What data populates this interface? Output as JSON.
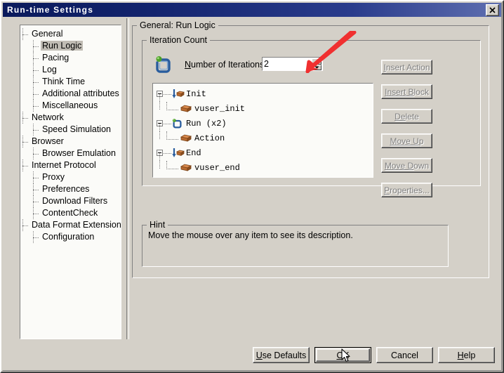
{
  "window": {
    "title": "Run-time Settings",
    "close_label": "✕"
  },
  "sidebar": {
    "items": [
      {
        "label": "General",
        "level": 0,
        "selected": false
      },
      {
        "label": "Run Logic",
        "level": 1,
        "selected": true
      },
      {
        "label": "Pacing",
        "level": 1,
        "selected": false
      },
      {
        "label": "Log",
        "level": 1,
        "selected": false
      },
      {
        "label": "Think Time",
        "level": 1,
        "selected": false
      },
      {
        "label": "Additional attributes",
        "level": 1,
        "selected": false
      },
      {
        "label": "Miscellaneous",
        "level": 1,
        "selected": false
      },
      {
        "label": "Network",
        "level": 0,
        "selected": false
      },
      {
        "label": "Speed Simulation",
        "level": 1,
        "selected": false
      },
      {
        "label": "Browser",
        "level": 0,
        "selected": false
      },
      {
        "label": "Browser Emulation",
        "level": 1,
        "selected": false
      },
      {
        "label": "Internet Protocol",
        "level": 0,
        "selected": false
      },
      {
        "label": "Proxy",
        "level": 1,
        "selected": false
      },
      {
        "label": "Preferences",
        "level": 1,
        "selected": false
      },
      {
        "label": "Download Filters",
        "level": 1,
        "selected": false
      },
      {
        "label": "ContentCheck",
        "level": 1,
        "selected": false
      },
      {
        "label": "Data Format Extension",
        "level": 0,
        "selected": false
      },
      {
        "label": "Configuration",
        "level": 1,
        "selected": false
      }
    ]
  },
  "main": {
    "group_title": "General: Run Logic",
    "iteration_group_title": "Iteration Count",
    "iteration_label_prefix": "N",
    "iteration_label_rest": "umber of Iterations:",
    "iteration_value": "2",
    "hint_group_title": "Hint",
    "hint_text": "Move the mouse over any item to see its description.",
    "logic_tree": [
      {
        "label": "Init",
        "level": 0,
        "icon": "action-arrow-down-icon",
        "expander": true
      },
      {
        "label": "vuser_init",
        "level": 1,
        "icon": "brick-icon",
        "expander": false
      },
      {
        "label": "Run  (x2)",
        "level": 0,
        "icon": "loop-icon",
        "expander": true
      },
      {
        "label": "Action",
        "level": 1,
        "icon": "brick-icon",
        "expander": false
      },
      {
        "label": "End",
        "level": 0,
        "icon": "action-arrow-down-icon",
        "expander": true
      },
      {
        "label": "vuser_end",
        "level": 1,
        "icon": "brick-icon",
        "expander": false
      }
    ],
    "side_buttons": [
      {
        "pre": "I",
        "post": "nsert Action",
        "name": "insert-action-button",
        "disabled": true
      },
      {
        "pre": "Insert B",
        "post": "lock",
        "name": "insert-block-button",
        "disabled": true
      },
      {
        "pre": "De",
        "post": "lete",
        "name": "delete-button",
        "disabled": true
      },
      {
        "pre": "Move U",
        "post": "p",
        "name": "move-up-button",
        "disabled": true
      },
      {
        "pre": "Move D",
        "post": "own",
        "name": "move-down-button",
        "disabled": true
      },
      {
        "pre": "P",
        "post": "roperties...",
        "name": "properties-button",
        "disabled": true
      }
    ]
  },
  "footer": {
    "buttons": [
      {
        "pre": "U",
        "post": "se Defaults",
        "name": "use-defaults-button",
        "default": false
      },
      {
        "pre": "O",
        "post": "K",
        "name": "ok-button",
        "default": true
      },
      {
        "pre": "",
        "post": "Cancel",
        "name": "cancel-button",
        "default": false
      },
      {
        "pre": "H",
        "post": "elp",
        "name": "help-button",
        "default": false
      }
    ]
  },
  "annotation": {
    "arrow_color": "#f03030",
    "cursor": "mouse-pointer"
  },
  "colors": {
    "dialog_face": "#d4d0c8",
    "titlebar_start": "#0a1a5c",
    "titlebar_end": "#5f6fb0",
    "field_bg": "#fbfbf8",
    "selection": "#c0bcb4",
    "disabled_text": "#808080"
  }
}
